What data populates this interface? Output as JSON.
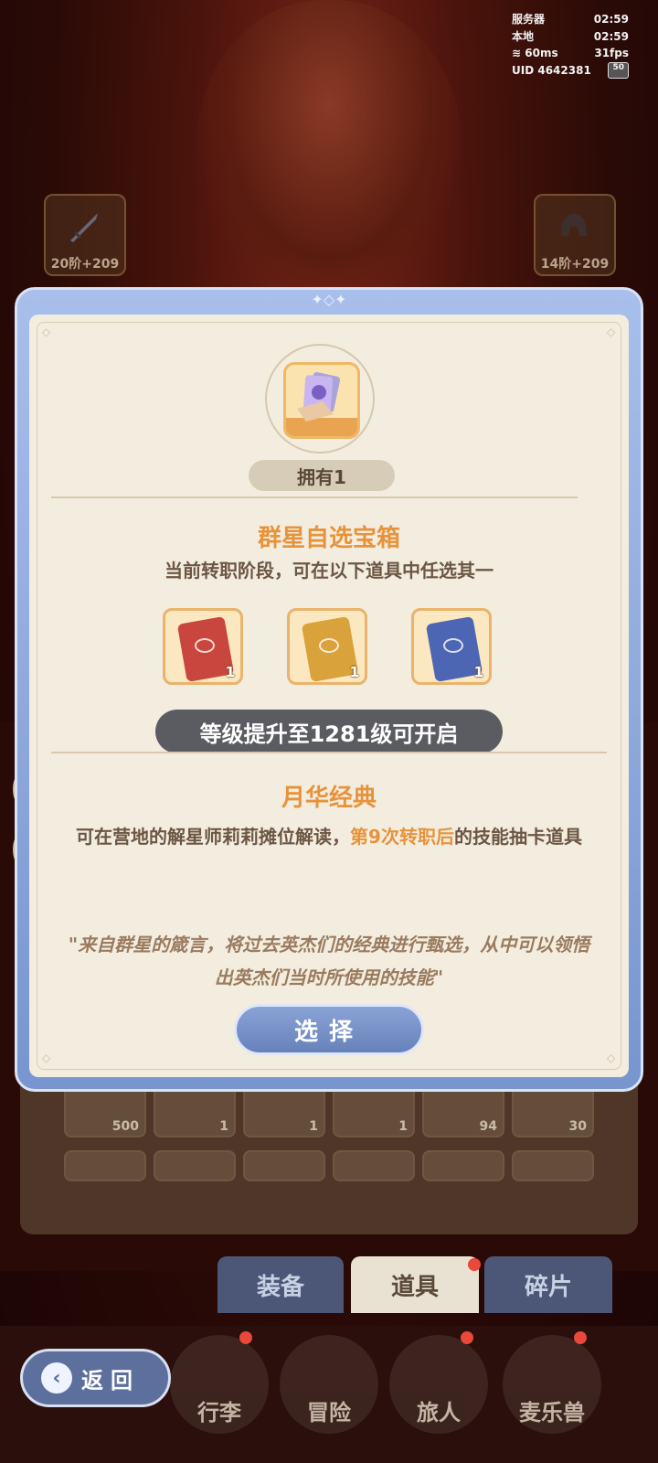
{
  "hud": {
    "server_label": "服务器",
    "server_time": "02:59",
    "local_label": "本地",
    "local_time": "02:59",
    "ping": "60ms",
    "fps": "31fps",
    "uid_label": "UID",
    "uid": "4642381",
    "battery": "50"
  },
  "slots": {
    "left_level": "20阶+209",
    "right_level": "14阶+209"
  },
  "dialog": {
    "own_count": "拥有1",
    "chest_title": "群星自选宝箱",
    "chest_desc": "当前转职阶段，可在以下道具中任选其一",
    "cards": [
      {
        "color": "#c8463d",
        "count": "1"
      },
      {
        "color": "#d9a23a",
        "count": "1"
      },
      {
        "color": "#4d66b3",
        "count": "1"
      }
    ],
    "unlock_text": "等级提升至1281级可开启",
    "item_title": "月华经典",
    "desc_prefix": "可在营地的解星师莉莉摊位解读，",
    "desc_highlight": "第9次转职后",
    "desc_suffix": "的技能抽卡道具",
    "quote": "\"来自群星的箴言，将过去英杰们的经典进行甄选，从中可以领悟出英杰们当时所使用的技能\"",
    "select_label": "选择"
  },
  "inventory_counts": [
    "500",
    "1",
    "1",
    "1",
    "94",
    "30"
  ],
  "tabs": {
    "equipment": "装备",
    "items": "道具",
    "fragments": "碎片"
  },
  "back_label": "返回",
  "nav": {
    "bag": "行李",
    "adventure": "冒险",
    "traveler": "旅人",
    "pet": "麦乐兽"
  },
  "colors": {
    "accent_orange": "#e7933a",
    "dialog_blue": "#7895cf",
    "paper": "#f3ede0"
  }
}
